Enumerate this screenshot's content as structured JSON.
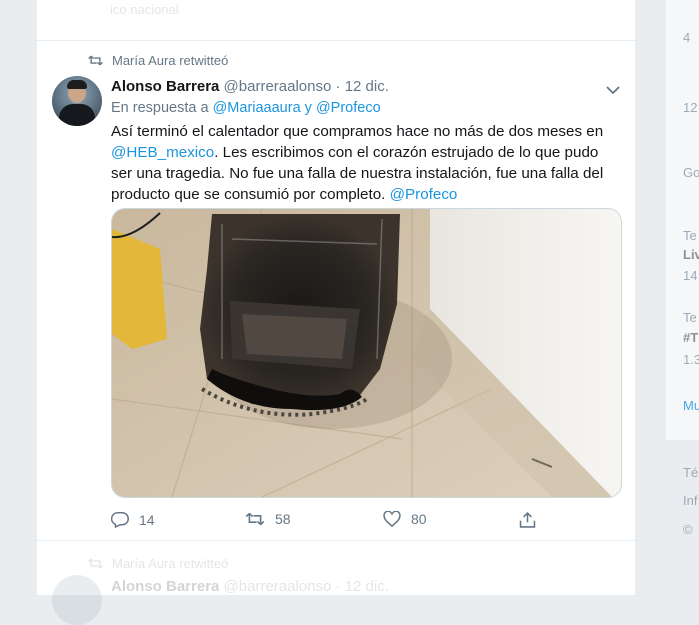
{
  "top_ghost_text": "ico nacional",
  "retweet": {
    "label": "María Aura retwitteó"
  },
  "tweet": {
    "author_name": "Alonso Barrera",
    "author_handle": "@barreraalonso",
    "separator": "·",
    "date": "12 dic.",
    "reply_prefix": "En respuesta a",
    "reply_to_1": "@Mariaaaura",
    "reply_and": "y",
    "reply_to_2": "@Profeco",
    "text_part1": "Así terminó el calentador que compramos hace no más de dos meses en",
    "text_mention1": "@HEB_mexico",
    "text_part2": ". Les escribimos con el corazón estrujado de lo que pudo ser una tragedia. No fue una falla de nuestra instalación, fue una falla del producto que se consumió por completo.",
    "text_mention2": "@Profeco",
    "image_alt": "Calentador quemado sobre el piso"
  },
  "actions": {
    "reply_count": "14",
    "retweet_count": "58",
    "like_count": "80"
  },
  "next_tweet": {
    "retweet_label": "María Aura retwitteó",
    "author_name": "Alonso Barrera",
    "author_handle": "@barreraalonso",
    "separator": "·",
    "date": "12 dic."
  },
  "sidebar_fragments": [
    "4",
    "12",
    "Go",
    "Te",
    "Liv",
    "14",
    "Te",
    "#T",
    "1.3",
    "Mu",
    "Té",
    "Inf",
    "©"
  ],
  "colors": {
    "link": "#1b95e0",
    "secondary_text": "#657786",
    "background": "#e9edf0"
  },
  "icons": [
    "retweet-icon",
    "chevron-down-icon",
    "reply-icon",
    "retweet-icon",
    "like-icon",
    "share-icon"
  ]
}
